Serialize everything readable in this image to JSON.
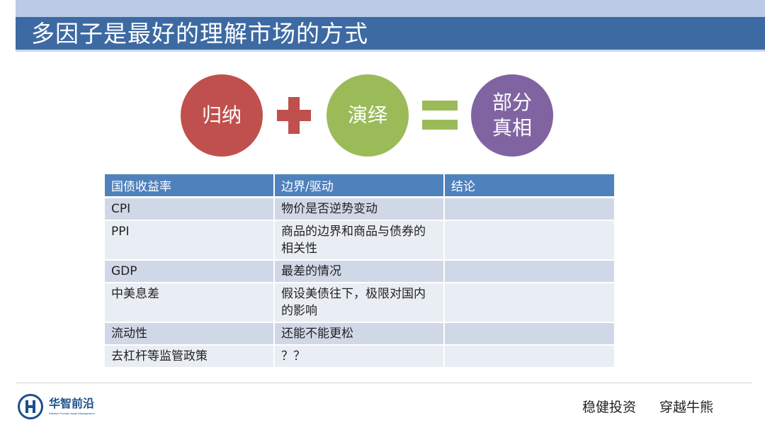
{
  "slide": {
    "title": "多因子是最好的理解市场的方式"
  },
  "formula": {
    "left": "归纳",
    "middle": "演绎",
    "result_line1": "部分",
    "result_line2": "真相",
    "left_color": "#c0504d",
    "middle_color": "#9bbb59",
    "result_color": "#8064a2"
  },
  "table": {
    "headers": [
      "国债收益率",
      "边界/驱动",
      "结论"
    ],
    "rows": [
      [
        "CPI",
        "物价是否逆势变动",
        ""
      ],
      [
        "PPI",
        "商品的边界和商品与债券的相关性",
        ""
      ],
      [
        "GDP",
        "最差的情况",
        ""
      ],
      [
        "中美息差",
        "假设美债往下，极限对国内的影响",
        ""
      ],
      [
        "流动性",
        "还能不能更松",
        ""
      ],
      [
        "去杠杆等监管政策",
        "？？",
        ""
      ]
    ],
    "header_color": "#4f81bd"
  },
  "footer": {
    "logo_name": "华智前沿",
    "logo_subtitle": "Wisdom Frontier Asset Management",
    "slogan_1": "稳健投资",
    "slogan_2": "穿越牛熊"
  }
}
